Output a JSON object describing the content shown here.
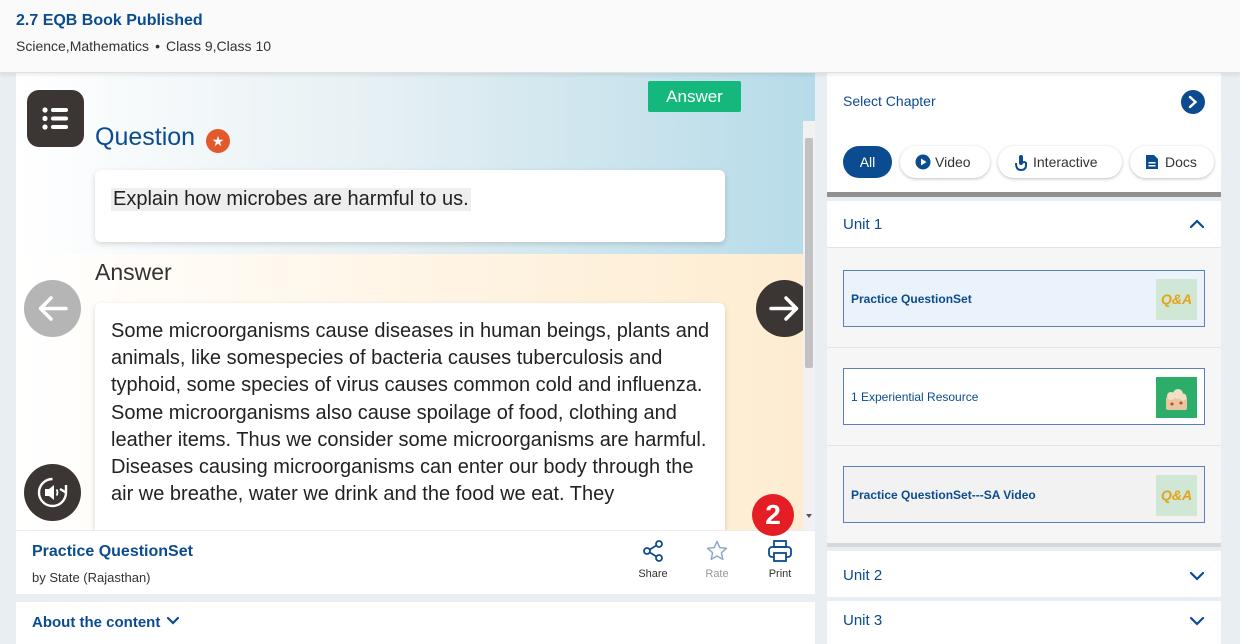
{
  "header": {
    "title": "2.7 EQB Book Published",
    "subjects": "Science,Mathematics",
    "separator": "•",
    "classes": "Class 9,Class 10"
  },
  "player": {
    "answer_button": "Answer",
    "question_heading": "Question",
    "question_text": "Explain how microbes are harmful to us.",
    "answer_heading": "Answer",
    "answer_paragraphs": [
      "Some microorganisms cause diseases in human beings, plants and animals, like somespecies of bacteria causes tuberculosis and typhoid, some species of virus causes common cold and influenza. Some microorganisms also cause spoilage of food, clothing and leather items. Thus we consider some microorganisms are harmful.",
      "Diseases causing microorganisms can enter our body through the air we breathe, water we drink and the food we eat. They"
    ],
    "page_badge": "2"
  },
  "content_info": {
    "title": "Practice QuestionSet",
    "by": "by State (Rajasthan)",
    "actions": {
      "share": "Share",
      "rate": "Rate",
      "print": "Print"
    }
  },
  "about": {
    "label": "About the content"
  },
  "sidebar": {
    "select_chapter": "Select Chapter",
    "filters": [
      {
        "label": "All",
        "active": true
      },
      {
        "label": "Video",
        "icon": "play-circle-icon"
      },
      {
        "label": "Interactive",
        "icon": "touch-icon"
      },
      {
        "label": "Docs",
        "icon": "document-icon"
      }
    ],
    "units": [
      {
        "label": "Unit 1",
        "expanded": true,
        "resources": [
          {
            "name": "Practice QuestionSet",
            "thumb": "Q&A"
          },
          {
            "name": "1 Experiential Resource",
            "thumb": ""
          },
          {
            "name": "Practice QuestionSet---SA Video",
            "thumb": "Q&A"
          }
        ]
      },
      {
        "label": "Unit 2",
        "expanded": false
      },
      {
        "label": "Unit 3",
        "expanded": false
      }
    ]
  },
  "colors": {
    "brand_blue": "#0b4b8f",
    "answer_green": "#14b87c",
    "star_orange": "#e25a2b",
    "badge_red": "#e51d24"
  }
}
